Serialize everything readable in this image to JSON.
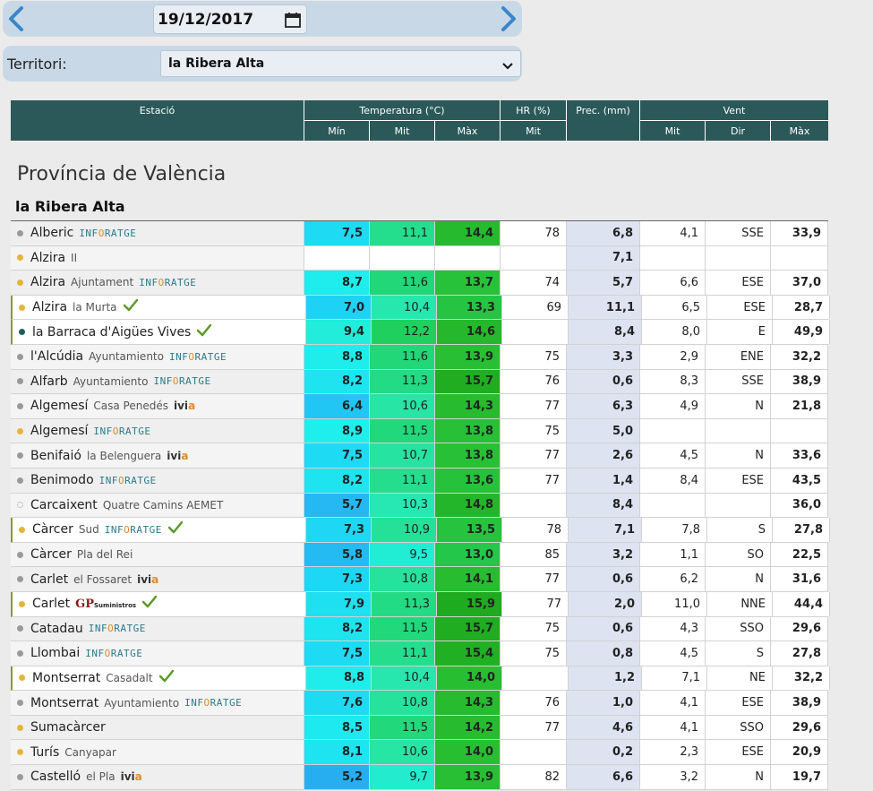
{
  "date": {
    "value": "19/12/2017"
  },
  "territory": {
    "label": "Territori:",
    "selected": "la Ribera Alta"
  },
  "header": {
    "estacio": "Estació",
    "temperatura": "Temperatura (°C)",
    "hr": "HR (%)",
    "prec": "Prec. (mm)",
    "vent": "Vent",
    "min": "Mín",
    "mit": "Mit",
    "max": "Màx",
    "hr_mit": "Mit",
    "vent_mit": "Mit",
    "vent_dir": "Dir",
    "vent_max": "Màx"
  },
  "province": "Província de València",
  "region": "la Ribera Alta",
  "colors": {
    "header_bg": "#2b5959",
    "dot_gray": "#9a9a9a",
    "dot_orange": "#e6b43a",
    "dot_teal": "#1f5e5e",
    "check_green": "#5a9a2a"
  },
  "rows": [
    {
      "name": "Alberic",
      "sub": "",
      "source": "inforatge",
      "dot": "gray",
      "check": false,
      "min": "7,5",
      "mit": "11,1",
      "max": "14,4",
      "hr": "78",
      "prec": "6,8",
      "vmit": "4,1",
      "vdir": "SSE",
      "vmax": "33,9"
    },
    {
      "name": "Alzira",
      "sub": "II",
      "source": "",
      "dot": "orange",
      "check": false,
      "min": "",
      "mit": "",
      "max": "",
      "hr": "",
      "prec": "7,1",
      "vmit": "",
      "vdir": "",
      "vmax": ""
    },
    {
      "name": "Alzira",
      "sub": "Ajuntament",
      "source": "inforatge",
      "dot": "orange",
      "check": false,
      "min": "8,7",
      "mit": "11,6",
      "max": "13,7",
      "hr": "74",
      "prec": "5,7",
      "vmit": "6,6",
      "vdir": "ESE",
      "vmax": "37,0"
    },
    {
      "name": "Alzira",
      "sub": "la Murta",
      "source": "",
      "dot": "orange",
      "check": true,
      "min": "7,0",
      "mit": "10,4",
      "max": "13,3",
      "hr": "69",
      "prec": "11,1",
      "vmit": "6,5",
      "vdir": "ESE",
      "vmax": "28,7"
    },
    {
      "name": "la Barraca d'Aigües Vives",
      "sub": "",
      "source": "",
      "dot": "teal",
      "check": true,
      "min": "9,4",
      "mit": "12,2",
      "max": "14,6",
      "hr": "",
      "prec": "8,4",
      "vmit": "8,0",
      "vdir": "E",
      "vmax": "49,9"
    },
    {
      "name": "l'Alcúdia",
      "sub": "Ayuntamiento",
      "source": "inforatge",
      "dot": "gray",
      "check": false,
      "min": "8,8",
      "mit": "11,6",
      "max": "13,9",
      "hr": "75",
      "prec": "3,3",
      "vmit": "2,9",
      "vdir": "ENE",
      "vmax": "32,2"
    },
    {
      "name": "Alfarb",
      "sub": "Ayuntamiento",
      "source": "inforatge",
      "dot": "gray",
      "check": false,
      "min": "8,2",
      "mit": "11,3",
      "max": "15,7",
      "hr": "76",
      "prec": "0,6",
      "vmit": "8,3",
      "vdir": "SSE",
      "vmax": "38,9"
    },
    {
      "name": "Algemesí",
      "sub": "Casa Penedés",
      "source": "ivia",
      "dot": "gray",
      "check": false,
      "min": "6,4",
      "mit": "10,6",
      "max": "14,3",
      "hr": "77",
      "prec": "6,3",
      "vmit": "4,9",
      "vdir": "N",
      "vmax": "21,8"
    },
    {
      "name": "Algemesí",
      "sub": "",
      "source": "inforatge",
      "dot": "orange",
      "check": false,
      "min": "8,9",
      "mit": "11,5",
      "max": "13,8",
      "hr": "75",
      "prec": "5,0",
      "vmit": "",
      "vdir": "",
      "vmax": ""
    },
    {
      "name": "Benifaió",
      "sub": "la Belenguera",
      "source": "ivia",
      "dot": "gray",
      "check": false,
      "min": "7,5",
      "mit": "10,7",
      "max": "13,8",
      "hr": "77",
      "prec": "2,6",
      "vmit": "4,5",
      "vdir": "N",
      "vmax": "33,6"
    },
    {
      "name": "Benimodo",
      "sub": "",
      "source": "inforatge",
      "dot": "gray",
      "check": false,
      "min": "8,2",
      "mit": "11,1",
      "max": "13,6",
      "hr": "77",
      "prec": "1,4",
      "vmit": "8,4",
      "vdir": "ESE",
      "vmax": "43,5"
    },
    {
      "name": "Carcaixent",
      "sub": "Quatre Camins AEMET",
      "source": "",
      "dot": "hollow",
      "check": false,
      "min": "5,7",
      "mit": "10,3",
      "max": "14,8",
      "hr": "",
      "prec": "8,4",
      "vmit": "",
      "vdir": "",
      "vmax": "36,0"
    },
    {
      "name": "Càrcer",
      "sub": "Sud",
      "source": "inforatge",
      "dot": "orange",
      "check": true,
      "min": "7,3",
      "mit": "10,9",
      "max": "13,5",
      "hr": "78",
      "prec": "7,1",
      "vmit": "7,8",
      "vdir": "S",
      "vmax": "27,8"
    },
    {
      "name": "Càrcer",
      "sub": "Pla del Rei",
      "source": "",
      "dot": "gray",
      "check": false,
      "min": "5,8",
      "mit": "9,5",
      "max": "13,0",
      "hr": "85",
      "prec": "3,2",
      "vmit": "1,1",
      "vdir": "SO",
      "vmax": "22,5"
    },
    {
      "name": "Carlet",
      "sub": "el Fossaret",
      "source": "ivia",
      "dot": "gray",
      "check": false,
      "min": "7,3",
      "mit": "10,8",
      "max": "14,1",
      "hr": "77",
      "prec": "0,6",
      "vmit": "6,2",
      "vdir": "N",
      "vmax": "31,6"
    },
    {
      "name": "Carlet",
      "sub": "",
      "source": "gp",
      "dot": "orange",
      "check": true,
      "min": "7,9",
      "mit": "11,3",
      "max": "15,9",
      "hr": "77",
      "prec": "2,0",
      "vmit": "11,0",
      "vdir": "NNE",
      "vmax": "44,4"
    },
    {
      "name": "Catadau",
      "sub": "",
      "source": "inforatge",
      "dot": "gray",
      "check": false,
      "min": "8,2",
      "mit": "11,5",
      "max": "15,7",
      "hr": "75",
      "prec": "0,6",
      "vmit": "4,3",
      "vdir": "SSO",
      "vmax": "29,6"
    },
    {
      "name": "Llombai",
      "sub": "",
      "source": "inforatge",
      "dot": "gray",
      "check": false,
      "min": "7,5",
      "mit": "11,1",
      "max": "15,4",
      "hr": "75",
      "prec": "0,8",
      "vmit": "4,5",
      "vdir": "S",
      "vmax": "27,8"
    },
    {
      "name": "Montserrat",
      "sub": "Casadalt",
      "source": "",
      "dot": "orange",
      "check": true,
      "min": "8,8",
      "mit": "10,4",
      "max": "14,0",
      "hr": "",
      "prec": "1,2",
      "vmit": "7,1",
      "vdir": "NE",
      "vmax": "32,2"
    },
    {
      "name": "Montserrat",
      "sub": "Ayuntamiento",
      "source": "inforatge",
      "dot": "gray",
      "check": false,
      "min": "7,6",
      "mit": "10,8",
      "max": "14,3",
      "hr": "76",
      "prec": "1,0",
      "vmit": "4,1",
      "vdir": "ESE",
      "vmax": "38,9"
    },
    {
      "name": "Sumacàrcer",
      "sub": "",
      "source": "",
      "dot": "orange",
      "check": false,
      "min": "8,5",
      "mit": "11,5",
      "max": "14,2",
      "hr": "77",
      "prec": "4,6",
      "vmit": "4,1",
      "vdir": "SSO",
      "vmax": "29,6"
    },
    {
      "name": "Turís",
      "sub": "Canyapar",
      "source": "",
      "dot": "orange",
      "check": false,
      "min": "8,1",
      "mit": "10,6",
      "max": "14,0",
      "hr": "",
      "prec": "0,2",
      "vmit": "2,3",
      "vdir": "ESE",
      "vmax": "20,9"
    },
    {
      "name": "Castelló",
      "sub": "el Pla",
      "source": "ivia",
      "dot": "gray",
      "check": false,
      "min": "5,2",
      "mit": "9,7",
      "max": "13,9",
      "hr": "82",
      "prec": "6,6",
      "vmit": "3,2",
      "vdir": "N",
      "vmax": "19,7"
    }
  ]
}
